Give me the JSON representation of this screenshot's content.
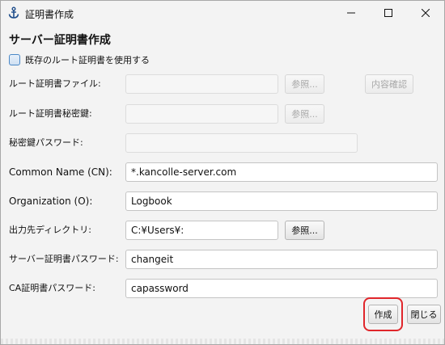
{
  "window": {
    "title": "証明書作成",
    "icon": "anchor-icon"
  },
  "heading": "サーバー証明書作成",
  "use_existing_root": {
    "label": "既存のルート証明書を使用する",
    "checked": false
  },
  "fields": {
    "root_cert_file": {
      "label": "ルート証明書ファイル:",
      "value": "",
      "enabled": false
    },
    "root_cert_key": {
      "label": "ルート証明書秘密鍵:",
      "value": "",
      "enabled": false
    },
    "key_password": {
      "label": "秘密鍵パスワード:",
      "value": "",
      "enabled": false
    },
    "common_name": {
      "label": "Common Name (CN):",
      "value": "*.kancolle-server.com"
    },
    "organization": {
      "label": "Organization (O):",
      "value": "Logbook"
    },
    "output_dir": {
      "label": "出力先ディレクトリ:",
      "value": "C:¥Users¥:"
    },
    "server_password": {
      "label": "サーバー証明書パスワード:",
      "value": "changeit"
    },
    "ca_password": {
      "label": "CA証明書パスワード:",
      "value": "capassword"
    }
  },
  "buttons": {
    "browse_root_file": "参照...",
    "verify_content": "内容確認",
    "browse_root_key": "参照...",
    "browse_output": "参照...",
    "create": "作成",
    "close": "閉じる"
  },
  "colors": {
    "window_bg": "#f3f3f3",
    "highlight": "#e0262b",
    "checkbox_accent": "#4a88c7"
  }
}
